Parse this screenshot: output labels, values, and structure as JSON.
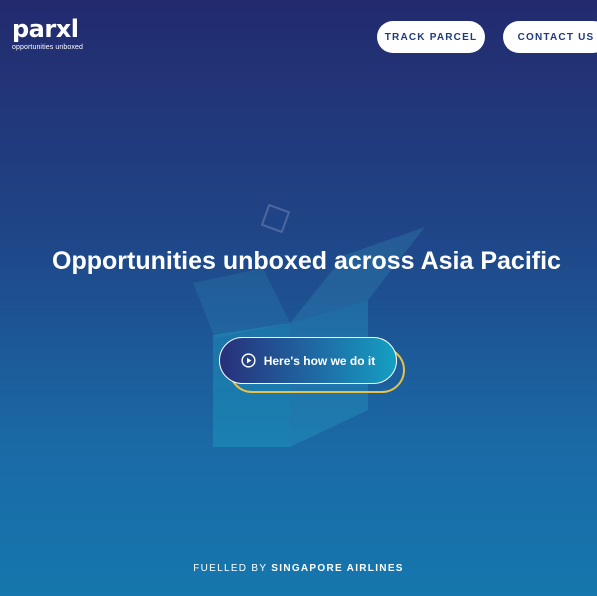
{
  "header": {
    "logo": {
      "word": "parxl",
      "tagline": "opportunities unboxed"
    },
    "nav": [
      {
        "label": "TRACK PARCEL"
      },
      {
        "label": "CONTACT US"
      }
    ]
  },
  "hero": {
    "headline": "Opportunities unboxed across Asia Pacific",
    "cta_label": "Here's how we do it"
  },
  "footer": {
    "prefix": "FUELLED BY",
    "brand": "SINGAPORE AIRLINES"
  },
  "colors": {
    "bg_top": "#232a6e",
    "bg_bottom": "#1577ad",
    "accent_yellow": "#e6c24a",
    "button_text": "#1f3a7a"
  },
  "icons": {
    "cta": "play-circle-icon",
    "art": "open-box-illustration"
  }
}
